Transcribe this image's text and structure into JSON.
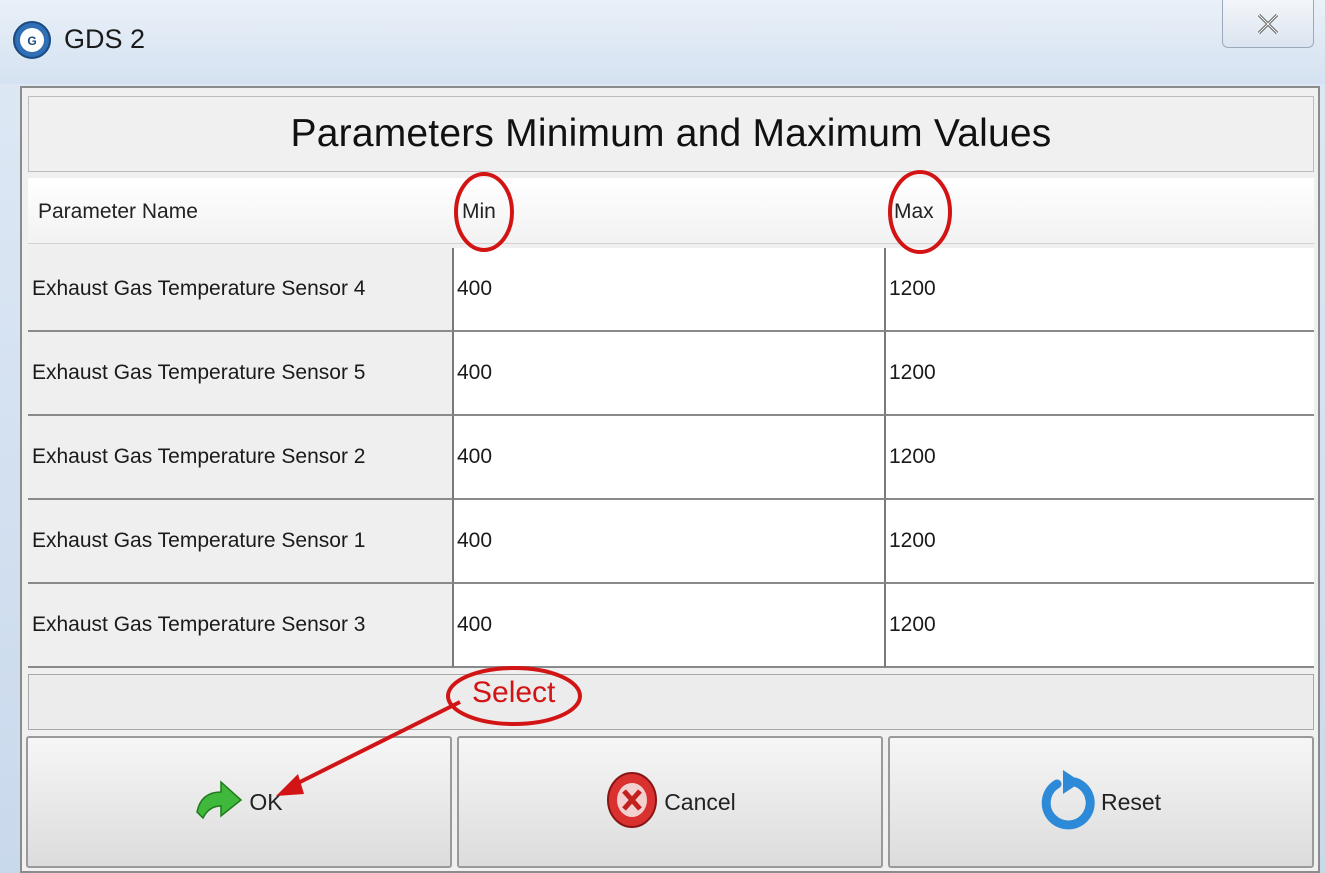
{
  "window": {
    "title": "GDS 2",
    "app_icon": "gds-logo-icon",
    "close_icon": "close-icon"
  },
  "dialog": {
    "heading": "Parameters Minimum and Maximum Values",
    "columns": {
      "name": "Parameter Name",
      "min": "Min",
      "max": "Max"
    },
    "rows": [
      {
        "name": "Exhaust Gas Temperature Sensor 4",
        "min": "400",
        "max": "1200"
      },
      {
        "name": "Exhaust Gas Temperature Sensor 5",
        "min": "400",
        "max": "1200"
      },
      {
        "name": "Exhaust Gas Temperature Sensor 2",
        "min": "400",
        "max": "1200"
      },
      {
        "name": "Exhaust Gas Temperature Sensor 1",
        "min": "400",
        "max": "1200"
      },
      {
        "name": "Exhaust Gas Temperature Sensor 3",
        "min": "400",
        "max": "1200"
      }
    ]
  },
  "buttons": {
    "ok": {
      "label": "OK",
      "icon": "green-arrow-icon"
    },
    "cancel": {
      "label": "Cancel",
      "icon": "cancel-icon"
    },
    "reset": {
      "label": "Reset",
      "icon": "reset-icon"
    }
  },
  "annotations": {
    "select_label": "Select",
    "color": "#d21414"
  }
}
